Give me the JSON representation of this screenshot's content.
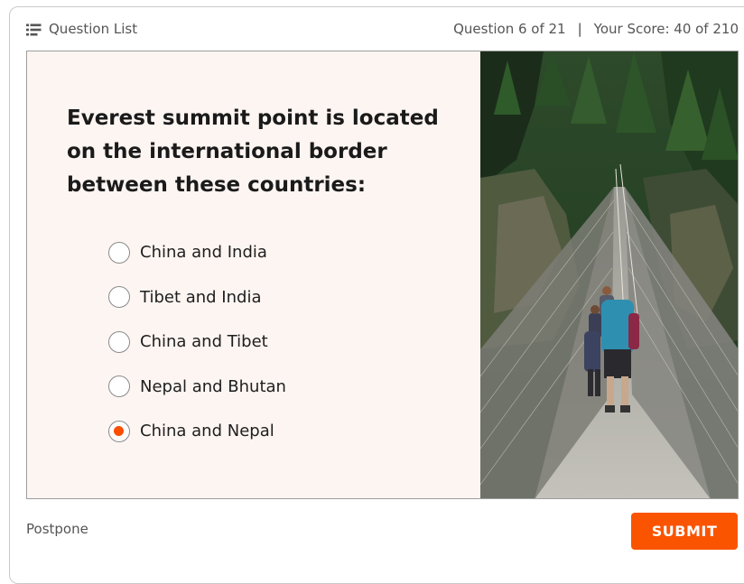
{
  "header": {
    "question_list_label": "Question List",
    "question_counter": "Question 6 of 21",
    "separator": "|",
    "score": "Your Score: 40 of 210"
  },
  "question": {
    "text": "Everest summit point is located on the international border between these countries:",
    "options": [
      {
        "label": "China and India",
        "selected": false
      },
      {
        "label": "Tibet and India",
        "selected": false
      },
      {
        "label": "China and Tibet",
        "selected": false
      },
      {
        "label": "Nepal and Bhutan",
        "selected": false
      },
      {
        "label": "China and Nepal",
        "selected": true
      }
    ]
  },
  "footer": {
    "postpone_label": "Postpone",
    "submit_label": "SUBMIT"
  },
  "colors": {
    "accent": "#fa5400",
    "card_bg": "#fdf5f2"
  },
  "icons": {
    "question_list": "list-icon"
  }
}
